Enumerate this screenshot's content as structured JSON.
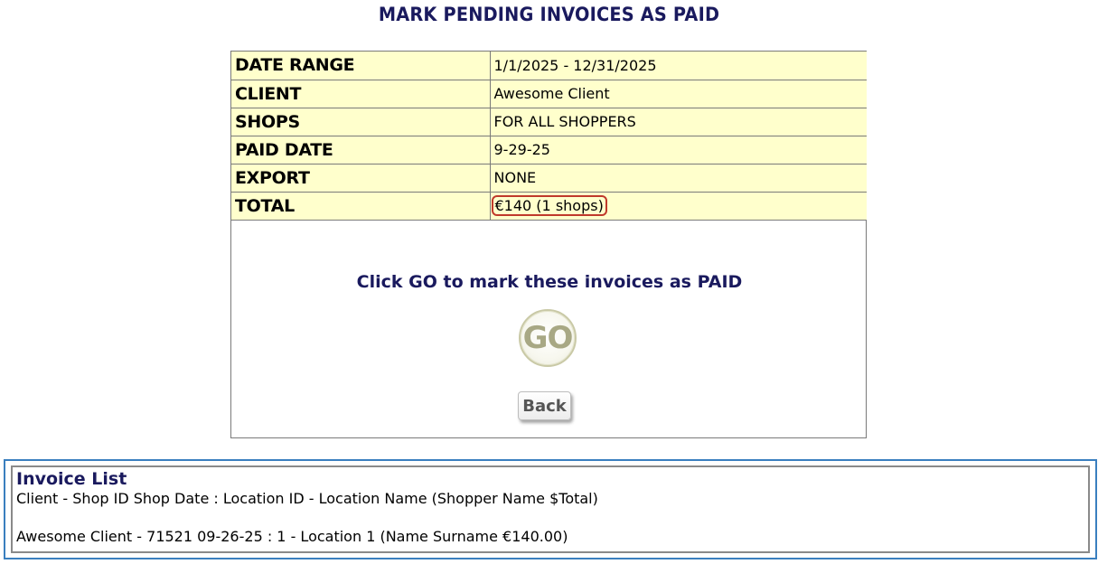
{
  "page": {
    "title": "MARK PENDING INVOICES AS PAID"
  },
  "summary": {
    "rows": [
      {
        "label": "DATE RANGE",
        "value": "1/1/2025 - 12/31/2025"
      },
      {
        "label": "CLIENT",
        "value": "Awesome Client"
      },
      {
        "label": "SHOPS",
        "value": "FOR ALL SHOPPERS"
      },
      {
        "label": "PAID DATE",
        "value": "9-29-25"
      },
      {
        "label": "EXPORT",
        "value": "NONE"
      },
      {
        "label": "TOTAL",
        "value": "€140 (1 shops)"
      }
    ],
    "highlight_color": "#c0392b",
    "row_background": "#ffffcc"
  },
  "actions": {
    "instruction": "Click GO to mark these invoices as PAID",
    "go_label": "GO",
    "back_label": "Back"
  },
  "invoice_list": {
    "title": "Invoice List",
    "header": "Client - Shop ID Shop Date : Location ID - Location Name (Shopper Name $Total)",
    "items": [
      "Awesome Client - 71521 09-26-25 : 1 - Location 1 (Name Surname €140.00)"
    ],
    "border_color": "#3a7fbf"
  }
}
